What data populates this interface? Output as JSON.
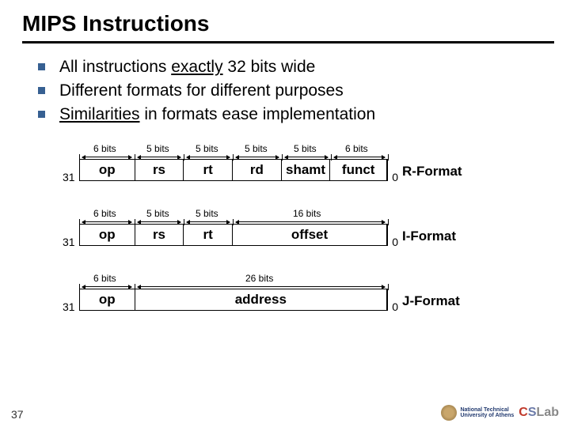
{
  "title": "MIPS Instructions",
  "bullets": {
    "b1a": "All instructions ",
    "b1u": "exactly",
    "b1b": " 32 bits wide",
    "b2": "Different formats for different purposes",
    "b3u": "Similarities",
    "b3b": " in formats ease implementation"
  },
  "bits": {
    "b6": "6 bits",
    "b5": "5 bits",
    "b16": "16 bits",
    "b26": "26 bits"
  },
  "fields": {
    "op": "op",
    "rs": "rs",
    "rt": "rt",
    "rd": "rd",
    "shamt": "shamt",
    "funct": "funct",
    "offset": "offset",
    "address": "address"
  },
  "nums": {
    "n31": "31",
    "n0": "0"
  },
  "formats": {
    "r": "R-Format",
    "i": "I-Format",
    "j": "J-Format"
  },
  "footer": {
    "page": "37"
  },
  "logo": {
    "inst1": "National Technical",
    "inst2": "University of Athens",
    "cs": "CSLab"
  },
  "chart_data": [
    {
      "type": "table",
      "title": "R-Format",
      "total_bits": 32,
      "fields": [
        {
          "name": "op",
          "bits": 6
        },
        {
          "name": "rs",
          "bits": 5
        },
        {
          "name": "rt",
          "bits": 5
        },
        {
          "name": "rd",
          "bits": 5
        },
        {
          "name": "shamt",
          "bits": 5
        },
        {
          "name": "funct",
          "bits": 6
        }
      ],
      "msb": 31,
      "lsb": 0
    },
    {
      "type": "table",
      "title": "I-Format",
      "total_bits": 32,
      "fields": [
        {
          "name": "op",
          "bits": 6
        },
        {
          "name": "rs",
          "bits": 5
        },
        {
          "name": "rt",
          "bits": 5
        },
        {
          "name": "offset",
          "bits": 16
        }
      ],
      "msb": 31,
      "lsb": 0
    },
    {
      "type": "table",
      "title": "J-Format",
      "total_bits": 32,
      "fields": [
        {
          "name": "op",
          "bits": 6
        },
        {
          "name": "address",
          "bits": 26
        }
      ],
      "msb": 31,
      "lsb": 0
    }
  ]
}
